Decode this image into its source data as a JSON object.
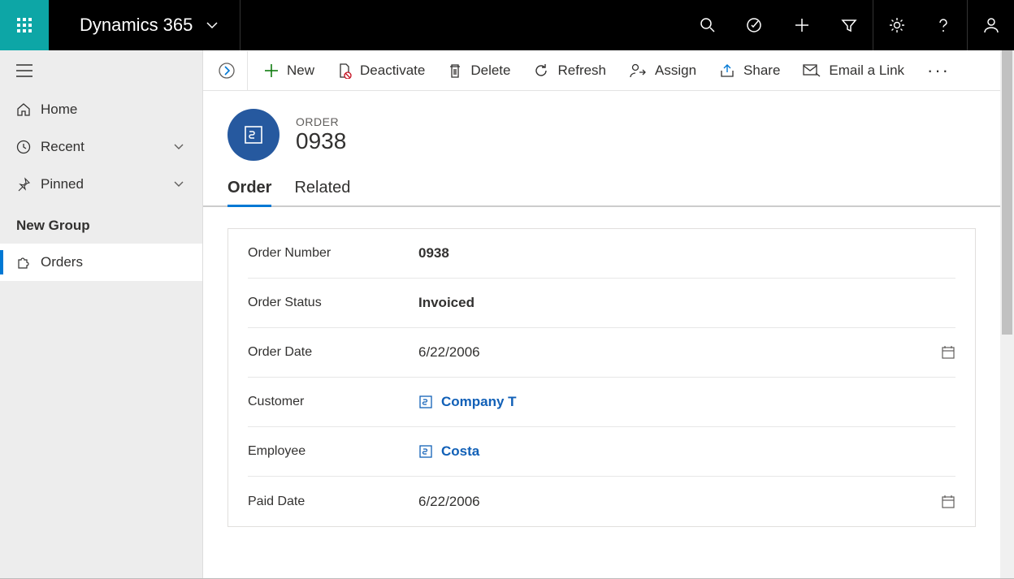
{
  "topbar": {
    "app_title": "Dynamics 365"
  },
  "nav": {
    "home": "Home",
    "recent": "Recent",
    "pinned": "Pinned",
    "group_label": "New Group",
    "orders": "Orders"
  },
  "commands": {
    "new": "New",
    "deactivate": "Deactivate",
    "delete": "Delete",
    "refresh": "Refresh",
    "assign": "Assign",
    "share": "Share",
    "email_link": "Email a Link"
  },
  "record": {
    "entity_label": "ORDER",
    "title": "0938"
  },
  "tabs": {
    "order": "Order",
    "related": "Related"
  },
  "form": {
    "order_number_label": "Order Number",
    "order_number_value": "0938",
    "order_status_label": "Order Status",
    "order_status_value": "Invoiced",
    "order_date_label": "Order Date",
    "order_date_value": "6/22/2006",
    "customer_label": "Customer",
    "customer_value": "Company T",
    "employee_label": "Employee",
    "employee_value": "Costa",
    "paid_date_label": "Paid Date",
    "paid_date_value": "6/22/2006"
  }
}
